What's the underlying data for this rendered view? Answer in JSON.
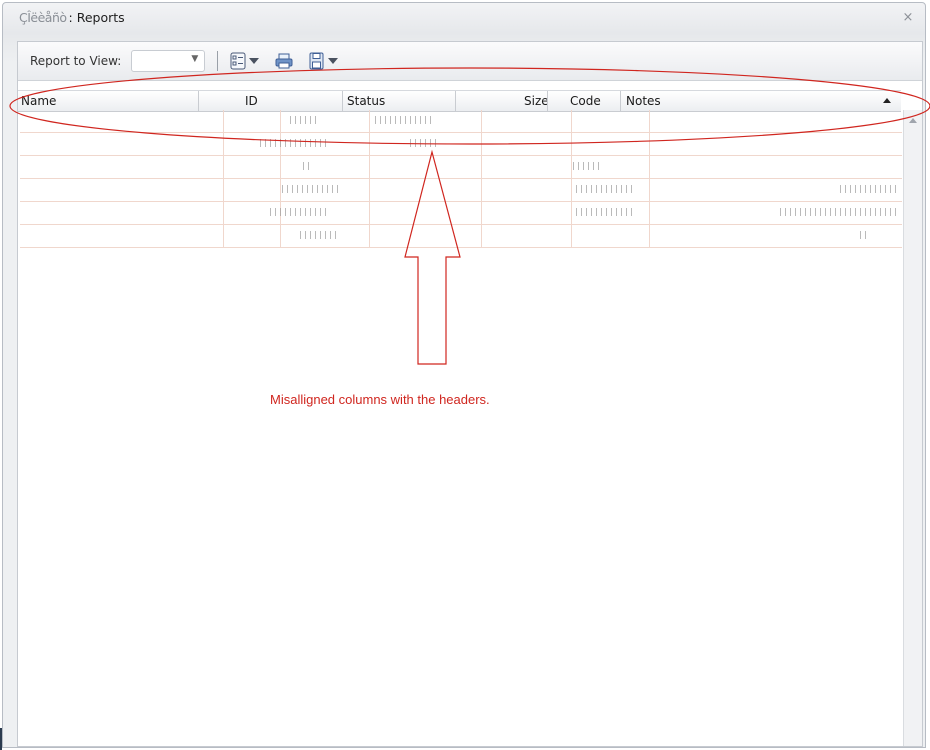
{
  "window": {
    "title_prefix": "ÇÎëèåñò",
    "title": "Reports",
    "close_glyph": "×"
  },
  "toolbar": {
    "report_label": "Report to View:",
    "report_select_value": "",
    "icons": [
      "list-view-icon",
      "print-icon",
      "save-icon"
    ]
  },
  "grid": {
    "columns": [
      {
        "label": "Name"
      },
      {
        "label": "ID"
      },
      {
        "label": "Status"
      },
      {
        "label": "Size"
      },
      {
        "label": "Code"
      },
      {
        "label": "Notes"
      }
    ],
    "rows": 6
  },
  "annotation": {
    "text": "Misalligned columns with the headers.",
    "color": "#d0261f"
  }
}
